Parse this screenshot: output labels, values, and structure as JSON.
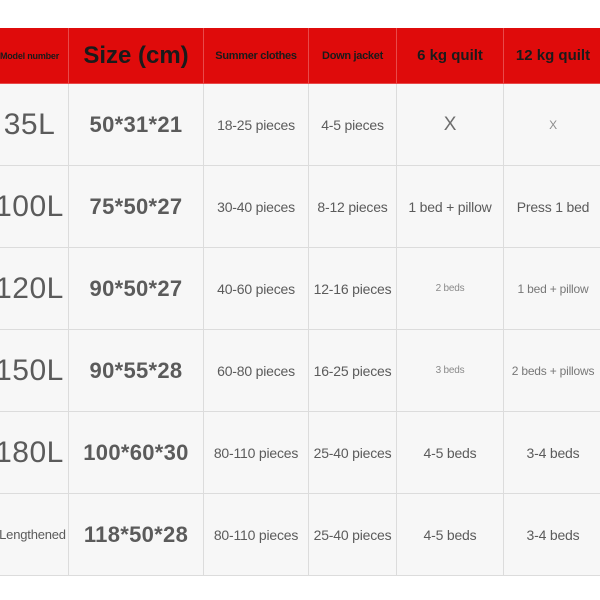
{
  "table": {
    "headers": [
      {
        "key": "model",
        "label": "Model number"
      },
      {
        "key": "size",
        "label": "Size (cm)"
      },
      {
        "key": "summer",
        "label": "Summer clothes"
      },
      {
        "key": "down",
        "label": "Down jacket"
      },
      {
        "key": "q6",
        "label": "6 kg quilt"
      },
      {
        "key": "q12",
        "label": "12 kg quilt"
      }
    ],
    "header_bg": "#df0b0b",
    "row_bg": "#f7f7f7",
    "grid_color": "#dcdcdc",
    "rows": [
      {
        "model": "35L",
        "size": "50*31*21",
        "summer": "18-25 pieces",
        "down": "4-5 pieces",
        "q6": "X",
        "q12": "X"
      },
      {
        "model": "100L",
        "size": "75*50*27",
        "summer": "30-40 pieces",
        "down": "8-12 pieces",
        "q6": "1 bed + pillow",
        "q12": "Press 1 bed"
      },
      {
        "model": "120L",
        "size": "90*50*27",
        "summer": "40-60 pieces",
        "down": "12-16 pieces",
        "q6": "2 beds",
        "q12": "1 bed + pillow"
      },
      {
        "model": "150L",
        "size": "90*55*28",
        "summer": "60-80 pieces",
        "down": "16-25 pieces",
        "q6": "3 beds",
        "q12": "2 beds + pillows"
      },
      {
        "model": "180L",
        "size": "100*60*30",
        "summer": "80-110 pieces",
        "down": "25-40 pieces",
        "q6": "4-5 beds",
        "q12": "3-4 beds"
      },
      {
        "model": "Lengthened",
        "size": "118*50*28",
        "summer": "80-110 pieces",
        "down": "25-40 pieces",
        "q6": "4-5 beds",
        "q12": "3-4 beds"
      }
    ]
  }
}
